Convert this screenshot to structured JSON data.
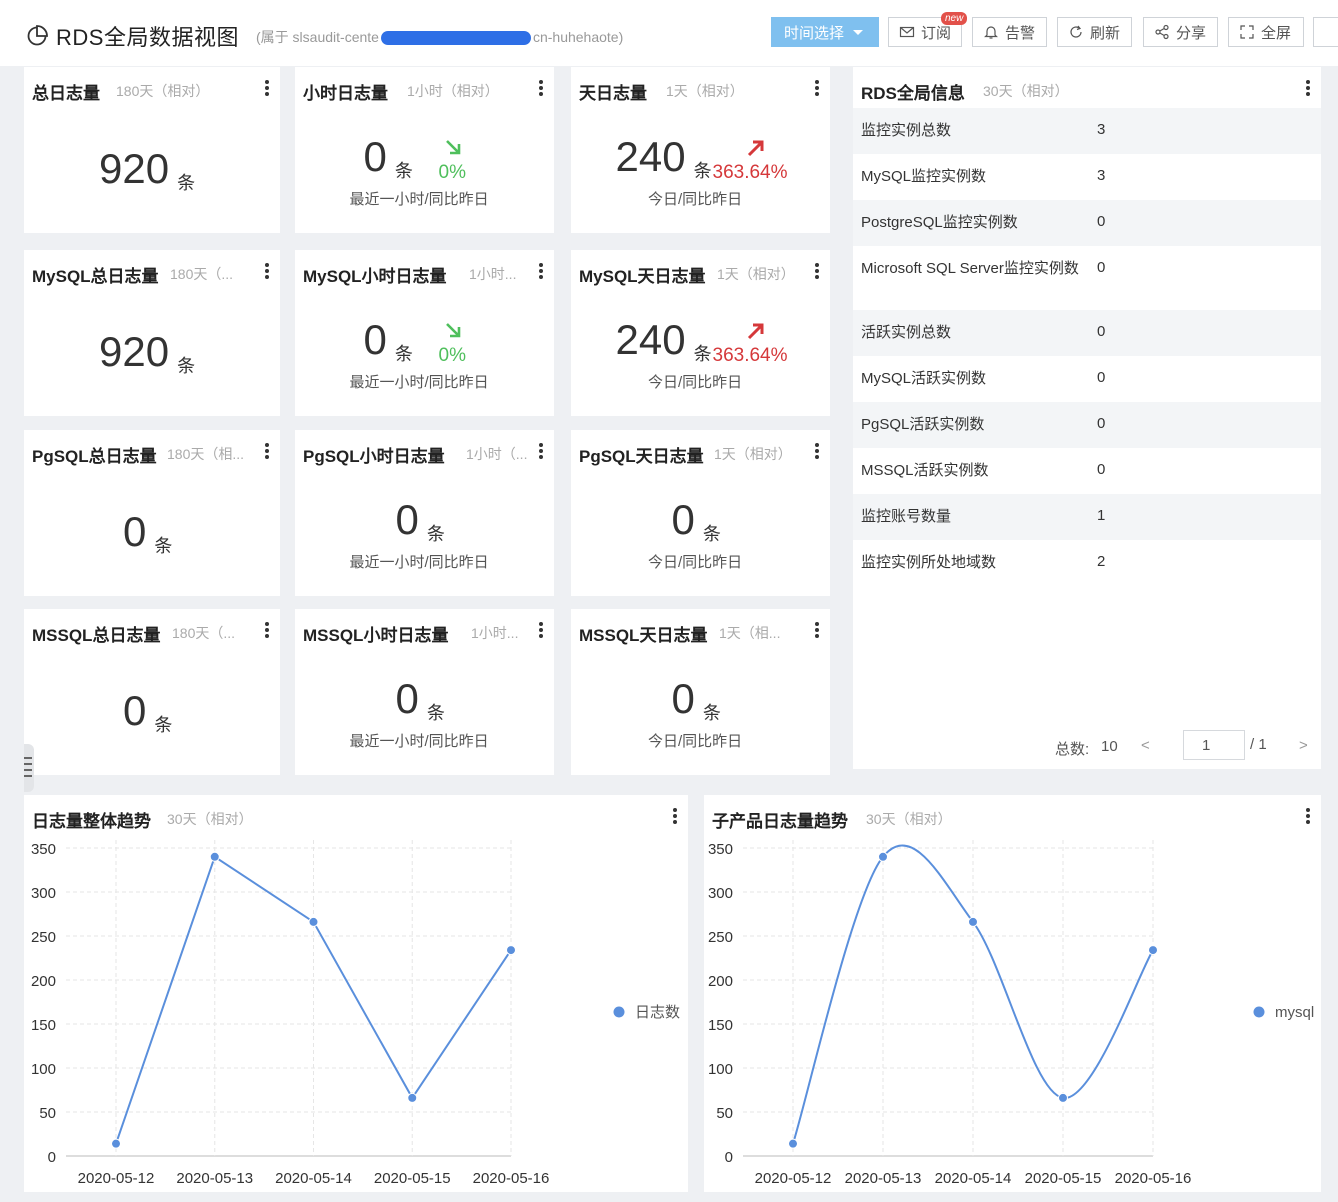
{
  "header": {
    "title": "RDS全局数据视图",
    "subtitle_prefix": "属于 slsaudit-cente",
    "subtitle_suffix": "cn-huhehaote",
    "buttons": {
      "time": "时间选择",
      "subscribe": "订阅",
      "new_badge": "new",
      "alarm": "告警",
      "refresh": "刷新",
      "share": "分享",
      "fullscreen": "全屏"
    }
  },
  "cards": [
    {
      "title": "总日志量",
      "range": "180天（相对）",
      "value": "920",
      "unit": "条",
      "caption": "",
      "trend": ""
    },
    {
      "title": "小时日志量",
      "range": "1小时（相对）",
      "value": "0",
      "unit": "条",
      "caption": "最近一小时/同比昨日",
      "trend": "down",
      "pct": "0%"
    },
    {
      "title": "天日志量",
      "range": "1天（相对）",
      "value": "240",
      "unit": "条",
      "caption": "今日/同比昨日",
      "trend": "up",
      "pct": "363.64%"
    },
    {
      "title": "MySQL总日志量",
      "range": "180天（...",
      "value": "920",
      "unit": "条",
      "caption": "",
      "trend": ""
    },
    {
      "title": "MySQL小时日志量",
      "range": "1小时...",
      "value": "0",
      "unit": "条",
      "caption": "最近一小时/同比昨日",
      "trend": "down",
      "pct": "0%"
    },
    {
      "title": "MySQL天日志量",
      "range": "1天（相对）",
      "value": "240",
      "unit": "条",
      "caption": "今日/同比昨日",
      "trend": "up",
      "pct": "363.64%"
    },
    {
      "title": "PgSQL总日志量",
      "range": "180天（相...",
      "value": "0",
      "unit": "条",
      "caption": "",
      "trend": ""
    },
    {
      "title": "PgSQL小时日志量",
      "range": "1小时（...",
      "value": "0",
      "unit": "条",
      "caption": "最近一小时/同比昨日",
      "trend": ""
    },
    {
      "title": "PgSQL天日志量",
      "range": "1天（相对）",
      "value": "0",
      "unit": "条",
      "caption": "今日/同比昨日",
      "trend": ""
    },
    {
      "title": "MSSQL总日志量",
      "range": "180天（...",
      "value": "0",
      "unit": "条",
      "caption": "",
      "trend": ""
    },
    {
      "title": "MSSQL小时日志量",
      "range": "1小时...",
      "value": "0",
      "unit": "条",
      "caption": "最近一小时/同比昨日",
      "trend": ""
    },
    {
      "title": "MSSQL天日志量",
      "range": "1天（相...",
      "value": "0",
      "unit": "条",
      "caption": "今日/同比昨日",
      "trend": ""
    }
  ],
  "info": {
    "title": "RDS全局信息",
    "range": "30天（相对）",
    "rows": [
      {
        "key": "监控实例总数",
        "value": "3"
      },
      {
        "key": "MySQL监控实例数",
        "value": "3"
      },
      {
        "key": "PostgreSQL监控实例数",
        "value": "0"
      },
      {
        "key": "Microsoft SQL Server监控实例数",
        "value": "0"
      },
      {
        "key": "活跃实例总数",
        "value": "0"
      },
      {
        "key": "MySQL活跃实例数",
        "value": "0"
      },
      {
        "key": "PgSQL活跃实例数",
        "value": "0"
      },
      {
        "key": "MSSQL活跃实例数",
        "value": "0"
      },
      {
        "key": "监控账号数量",
        "value": "1"
      },
      {
        "key": "监控实例所处地域数",
        "value": "2"
      }
    ],
    "pager": {
      "total_label": "总数:",
      "total": "10",
      "page": "1",
      "pages": "/ 1",
      "prev": "<",
      "next": ">"
    }
  },
  "chart_data": [
    {
      "type": "line",
      "title": "日志量整体趋势",
      "range": "30天（相对）",
      "categories": [
        "2020-05-12",
        "2020-05-13",
        "2020-05-14",
        "2020-05-15",
        "2020-05-16"
      ],
      "series": [
        {
          "name": "日志数",
          "values": [
            14,
            340,
            266,
            66,
            234
          ],
          "color": "#5a8fdc"
        }
      ],
      "ylim": [
        0,
        350
      ],
      "yticks": [
        0,
        50,
        100,
        150,
        200,
        250,
        300,
        350
      ],
      "smooth": false,
      "grid": true,
      "legend": "right"
    },
    {
      "type": "line",
      "title": "子产品日志量趋势",
      "range": "30天（相对）",
      "categories": [
        "2020-05-12",
        "2020-05-13",
        "2020-05-14",
        "2020-05-15",
        "2020-05-16"
      ],
      "series": [
        {
          "name": "mysql",
          "values": [
            14,
            340,
            266,
            66,
            234
          ],
          "color": "#5a8fdc"
        }
      ],
      "ylim": [
        0,
        350
      ],
      "yticks": [
        0,
        50,
        100,
        150,
        200,
        250,
        300,
        350
      ],
      "smooth": true,
      "grid": true,
      "legend": "right"
    }
  ]
}
